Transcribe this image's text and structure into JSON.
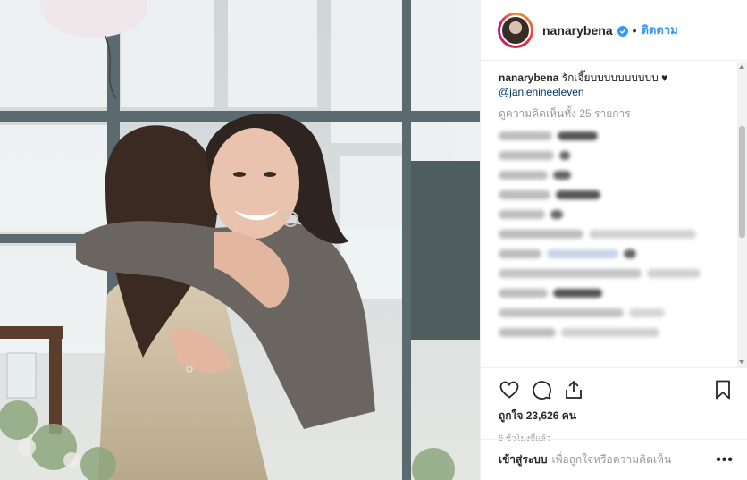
{
  "post": {
    "username": "nanarybena",
    "follow_label": "ติดตาม",
    "separator": "•",
    "caption_user": "nanarybena",
    "caption_text": " รักเจี๊ยบบบบบบบบบบ ♥",
    "mention": "@janienineeleven",
    "view_all_comments": "ดูความคิดเห็นทั้ง 25 รายการ",
    "likes": "ถูกใจ 23,626 คน",
    "time_ago": "6 ชั่วโมงที่แล้ว"
  },
  "login_bar": {
    "login_label": "เข้าสู่ระบบ",
    "login_prompt": "เพื่อถูกใจหรือความคิดเห็น",
    "more_label": "•••"
  },
  "icons": {
    "like": "heart-icon",
    "comment": "comment-icon",
    "share": "share-icon",
    "save": "bookmark-icon",
    "verified": "verified-badge-icon"
  },
  "colors": {
    "link_blue": "#3897f0",
    "mention_blue": "#003569",
    "text": "#262626",
    "muted": "#999999",
    "border": "#efefef"
  }
}
